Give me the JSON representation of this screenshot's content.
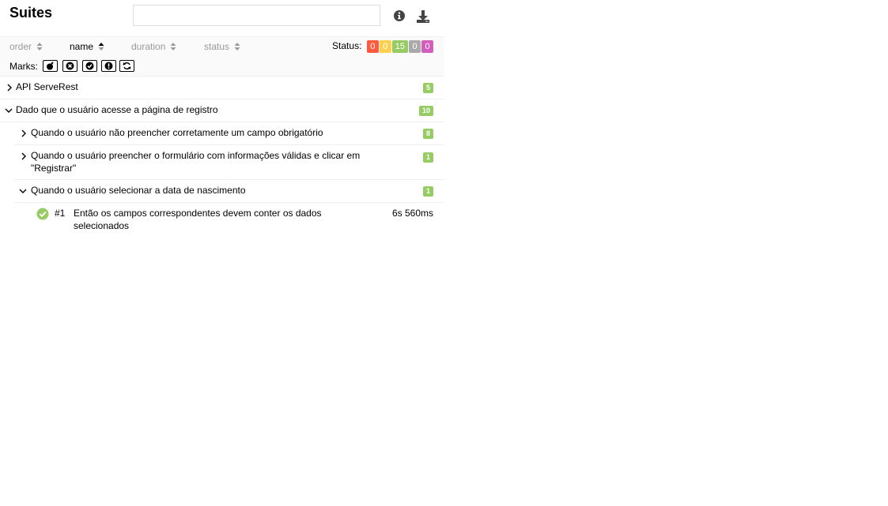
{
  "header": {
    "title": "Suites",
    "search_placeholder": "",
    "info_icon": "info-icon",
    "download_icon": "download-icon"
  },
  "sort": {
    "order": "order",
    "name": "name",
    "duration": "duration",
    "status": "status"
  },
  "status": {
    "label": "Status:",
    "counts": [
      {
        "key": "failed",
        "value": "0",
        "color": "#fd5a3e"
      },
      {
        "key": "broken",
        "value": "0",
        "color": "#ffd050"
      },
      {
        "key": "passed",
        "value": "15",
        "color": "#97cc64"
      },
      {
        "key": "skipped",
        "value": "0",
        "color": "#aaaaaa"
      },
      {
        "key": "unknown",
        "value": "0",
        "color": "#d35ebe"
      }
    ]
  },
  "marks": {
    "label": "Marks:",
    "icons": [
      "flaky-icon",
      "new-failed-icon",
      "new-passed-icon",
      "new-broken-icon",
      "retries-icon"
    ]
  },
  "tree": [
    {
      "label": "API ServeRest",
      "count": "5"
    },
    {
      "label": "Dado que o usuário acesse a página de registro",
      "count": "10"
    },
    {
      "label": "Quando o usuário não preencher corretamente um campo obrigatório",
      "count": "8"
    },
    {
      "label": "Quando o usuário preencher o formulário com informações válidas e clicar em \"Registrar\"",
      "count": "1"
    },
    {
      "label": "Quando o usuário selecionar a data de nascimento",
      "count": "1"
    }
  ],
  "test": {
    "index": "#1",
    "name": "Então os campos correspondentes devem conter os dados selecionados",
    "duration": "6s 560ms",
    "status_color": "#97cc64"
  }
}
